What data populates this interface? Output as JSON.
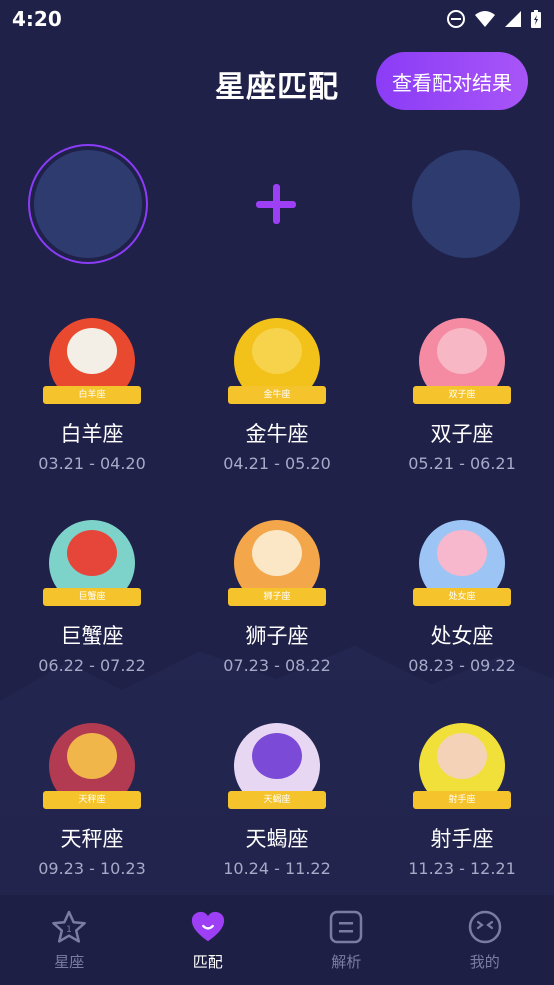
{
  "status_bar": {
    "time": "4:20"
  },
  "header": {
    "title": "星座匹配",
    "result_button": "查看配对结果"
  },
  "signs": [
    {
      "name": "白羊座",
      "dates": "03.21 - 04.20",
      "ribbon": "白羊座",
      "color": "#e94a2f",
      "face": "#f4efe6"
    },
    {
      "name": "金牛座",
      "dates": "04.21 - 05.20",
      "ribbon": "金牛座",
      "color": "#f2c21b",
      "face": "#f6d34a"
    },
    {
      "name": "双子座",
      "dates": "05.21 - 06.21",
      "ribbon": "双子座",
      "color": "#f58aa3",
      "face": "#f7b7c4"
    },
    {
      "name": "巨蟹座",
      "dates": "06.22 - 07.22",
      "ribbon": "巨蟹座",
      "color": "#7dd3c9",
      "face": "#e6453a"
    },
    {
      "name": "狮子座",
      "dates": "07.23 - 08.22",
      "ribbon": "狮子座",
      "color": "#f3a64a",
      "face": "#fbe7c6"
    },
    {
      "name": "处女座",
      "dates": "08.23 - 09.22",
      "ribbon": "处女座",
      "color": "#9cc5f5",
      "face": "#f7b7cc"
    },
    {
      "name": "天秤座",
      "dates": "09.23 - 10.23",
      "ribbon": "天秤座",
      "color": "#b23b52",
      "face": "#f1b64a"
    },
    {
      "name": "天蝎座",
      "dates": "10.24 - 11.22",
      "ribbon": "天蝎座",
      "color": "#e7d7f3",
      "face": "#7b4ad6"
    },
    {
      "name": "射手座",
      "dates": "11.23 - 12.21",
      "ribbon": "射手座",
      "color": "#f2e03a",
      "face": "#f3d2b8"
    }
  ],
  "bottom_nav": [
    {
      "label": "星座",
      "icon": "star-icon",
      "active": false
    },
    {
      "label": "匹配",
      "icon": "heart-icon",
      "active": true
    },
    {
      "label": "解析",
      "icon": "analysis-icon",
      "active": false
    },
    {
      "label": "我的",
      "icon": "profile-icon",
      "active": false
    }
  ],
  "colors": {
    "background": "#1f2149",
    "accent": "#8b3cf6",
    "text_muted": "#a7aac7"
  }
}
